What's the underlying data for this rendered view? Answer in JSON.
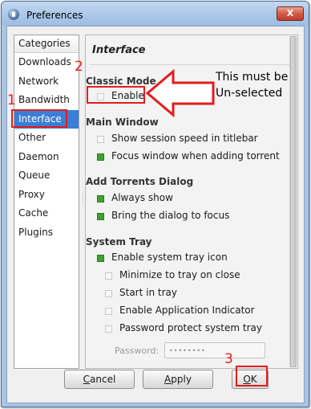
{
  "window": {
    "title": "Preferences",
    "close_label": "X"
  },
  "categories": {
    "header": "Categories",
    "items": [
      "Downloads",
      "Network",
      "Bandwidth",
      "Interface",
      "Other",
      "Daemon",
      "Queue",
      "Proxy",
      "Cache",
      "Plugins"
    ],
    "selected": "Interface"
  },
  "panel": {
    "title": "Interface",
    "sections": {
      "classic_mode": {
        "title": "Classic Mode",
        "enable": {
          "label": "Enable",
          "checked": false
        }
      },
      "main_window": {
        "title": "Main Window",
        "show_speed": {
          "label": "Show session speed in titlebar",
          "checked": false
        },
        "focus_window": {
          "label": "Focus window when adding torrent",
          "checked": true
        }
      },
      "add_torrents": {
        "title": "Add Torrents Dialog",
        "always_show": {
          "label": "Always show",
          "checked": true
        },
        "bring_focus": {
          "label": "Bring the dialog to focus",
          "checked": true
        }
      },
      "system_tray": {
        "title": "System Tray",
        "enable_tray": {
          "label": "Enable system tray icon",
          "checked": true
        },
        "minimize_close": {
          "label": "Minimize to tray on close",
          "checked": false
        },
        "start_tray": {
          "label": "Start in tray",
          "checked": false
        },
        "app_indicator": {
          "label": "Enable Application Indicator",
          "checked": false
        },
        "password_protect": {
          "label": "Password protect system tray",
          "checked": false
        },
        "password_label": "Password:",
        "password_value": "••••••••"
      }
    }
  },
  "buttons": {
    "cancel": {
      "prefix": "",
      "underlined": "C",
      "suffix": "ancel"
    },
    "apply": {
      "prefix": "",
      "underlined": "A",
      "suffix": "pply"
    },
    "ok": {
      "prefix": "",
      "underlined": "O",
      "suffix": "K"
    }
  },
  "annotations": {
    "step1": "1",
    "step2": "2",
    "step3": "3",
    "note_line1": "This must be",
    "note_line2": "Un-selected",
    "color": "#e21d1d"
  }
}
